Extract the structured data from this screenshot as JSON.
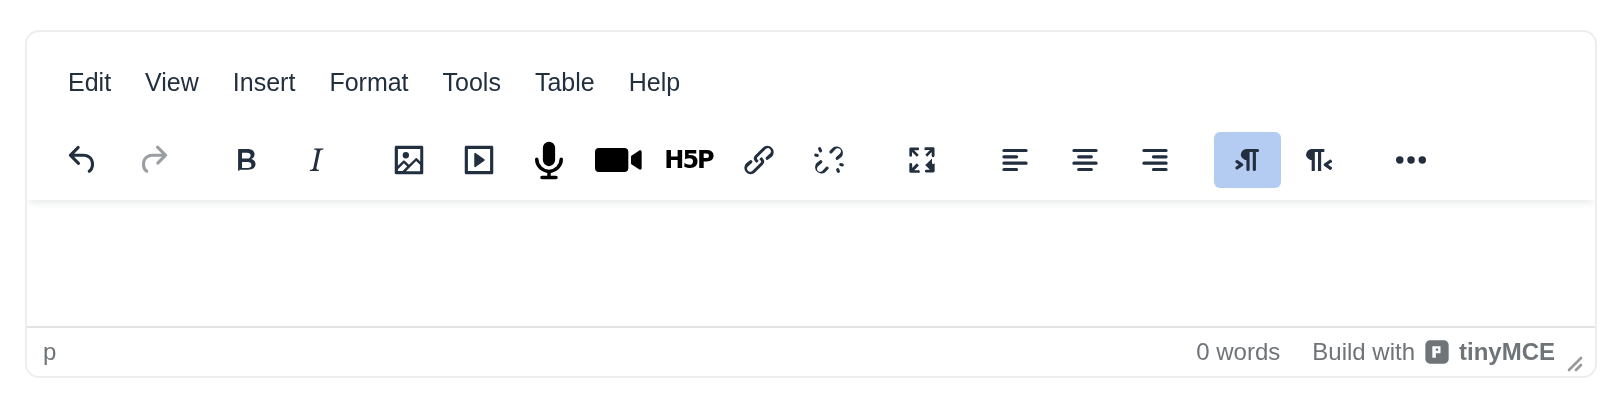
{
  "menubar": [
    {
      "label": "Edit"
    },
    {
      "label": "View"
    },
    {
      "label": "Insert"
    },
    {
      "label": "Format"
    },
    {
      "label": "Tools"
    },
    {
      "label": "Table"
    },
    {
      "label": "Help"
    }
  ],
  "toolbar": [
    {
      "buttons": [
        {
          "kind": "undo",
          "disabled": false,
          "active": false
        },
        {
          "kind": "redo",
          "disabled": true,
          "active": false
        }
      ]
    },
    {
      "buttons": [
        {
          "kind": "bold",
          "disabled": false,
          "active": false
        },
        {
          "kind": "italic",
          "disabled": false,
          "active": false
        }
      ]
    },
    {
      "buttons": [
        {
          "kind": "image",
          "disabled": false,
          "active": false
        },
        {
          "kind": "media",
          "disabled": false,
          "active": false
        },
        {
          "kind": "mic",
          "disabled": false,
          "active": false
        },
        {
          "kind": "video",
          "disabled": false,
          "active": false
        },
        {
          "kind": "h5p",
          "label": "H5P",
          "disabled": false,
          "active": false
        },
        {
          "kind": "link",
          "disabled": false,
          "active": false
        },
        {
          "kind": "unlink",
          "disabled": false,
          "active": false
        }
      ]
    },
    {
      "buttons": [
        {
          "kind": "fullscreen",
          "disabled": false,
          "active": false
        }
      ]
    },
    {
      "buttons": [
        {
          "kind": "align-left",
          "disabled": false,
          "active": false
        },
        {
          "kind": "align-center",
          "disabled": false,
          "active": false
        },
        {
          "kind": "align-right",
          "disabled": false,
          "active": false
        }
      ]
    },
    {
      "buttons": [
        {
          "kind": "ltr",
          "disabled": false,
          "active": true
        },
        {
          "kind": "rtl",
          "disabled": false,
          "active": false
        }
      ]
    },
    {
      "buttons": [
        {
          "kind": "more",
          "disabled": false,
          "active": false
        }
      ]
    }
  ],
  "status_bar": {
    "path": "p",
    "word_count": "0 words",
    "branding_prefix": "Build with",
    "branding": "tinyMCE"
  }
}
